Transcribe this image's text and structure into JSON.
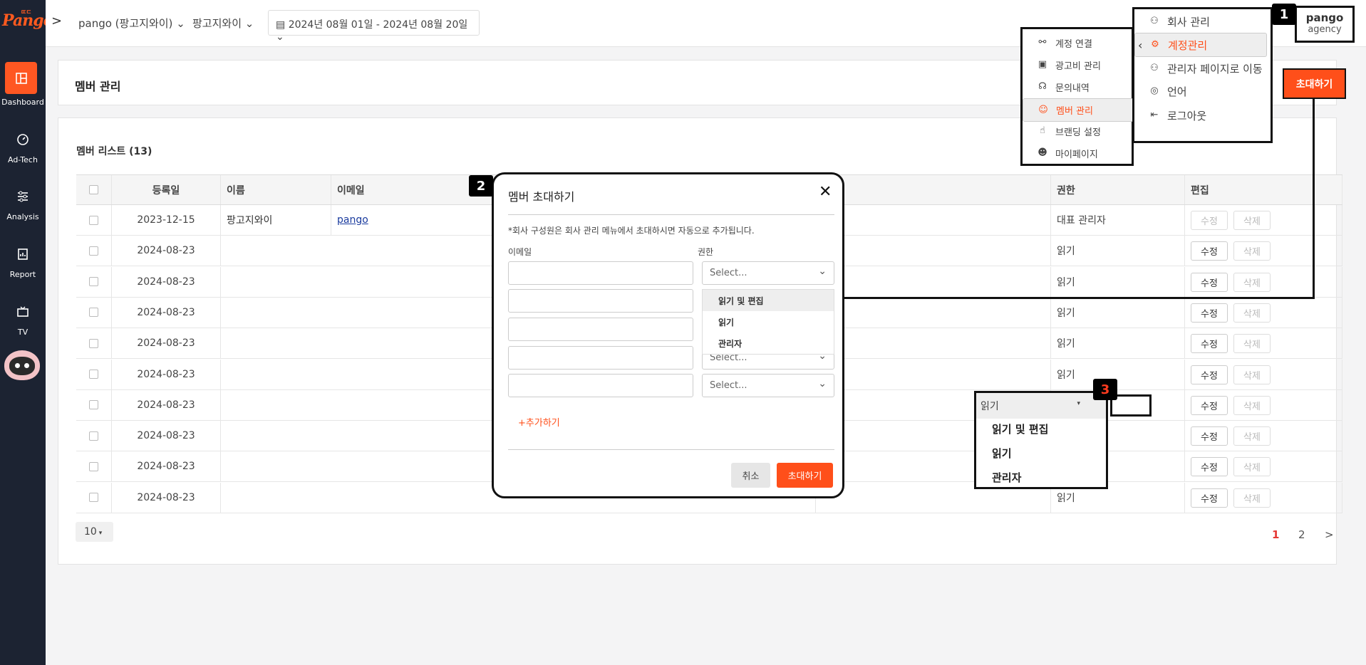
{
  "sidebar": {
    "logo_main": "Pango",
    "logo_small": "ㄸㄷ",
    "items": [
      {
        "label": "Dashboard",
        "icon": "dashboard-icon",
        "active": true
      },
      {
        "label": "Ad-Tech",
        "icon": "gauge-icon"
      },
      {
        "label": "Analysis",
        "icon": "sliders-icon"
      },
      {
        "label": "Report",
        "icon": "report-icon"
      },
      {
        "label": "TV",
        "icon": "tv-icon"
      }
    ]
  },
  "topbar": {
    "expand": ">",
    "account_select": "pango (팡고지와이)",
    "company_select": "팡고지와이",
    "date_range": "2024년 08월 01일 - 2024년 08월 20일",
    "profile_name": "pango",
    "profile_role": "agency"
  },
  "page": {
    "title": "멤버 관리",
    "list_title": "멤버 리스트 (13)",
    "invite_button": "초대하기"
  },
  "table": {
    "headers": {
      "date": "등록일",
      "name": "이름",
      "email": "이메일",
      "role": "권한",
      "edit": "편집"
    },
    "rows": [
      {
        "date": "2023-12-15",
        "name": "팡고지와이",
        "email": "pango",
        "role": "대표 관리자"
      },
      {
        "date": "2024-08-23",
        "role": "읽기"
      },
      {
        "date": "2024-08-23",
        "role": "읽기"
      },
      {
        "date": "2024-08-23",
        "role": "읽기"
      },
      {
        "date": "2024-08-23",
        "role": "읽기"
      },
      {
        "date": "2024-08-23",
        "role": "읽기"
      },
      {
        "date": "2024-08-23",
        "role": "읽기"
      },
      {
        "date": "2024-08-23",
        "role": "읽기"
      },
      {
        "date": "2024-08-23",
        "role": "읽기"
      },
      {
        "date": "2024-08-23",
        "role": "읽기"
      }
    ],
    "edit_label": "수정",
    "delete_label": "삭제",
    "page_size": "10",
    "pages": [
      "1",
      "2"
    ],
    "next": ">"
  },
  "account_menu": {
    "items": [
      "회사 관리",
      "계정관리",
      "관리자 페이지로 이동",
      "언어",
      "로그아웃"
    ],
    "icons": [
      "org-icon",
      "user-gear-icon",
      "admin-icon",
      "globe-icon",
      "logout-icon"
    ]
  },
  "sub_menu": {
    "items": [
      "계정 연결",
      "광고비 관리",
      "문의내역",
      "멤버 관리",
      "브랜딩 설정",
      "마이페이지"
    ],
    "icons": [
      "network-icon",
      "money-icon",
      "headset-icon",
      "member-icon",
      "click-icon",
      "user-circle-icon"
    ]
  },
  "modal": {
    "title": "멤버 초대하기",
    "notice": "*회사 구성원은 회사 관리 메뉴에서 초대하시면 자동으로 추가됩니다.",
    "email_label": "이메일",
    "role_label": "권한",
    "select_placeholder": "Select...",
    "dropdown_options": [
      "읽기 및 편집",
      "읽기",
      "관리자"
    ],
    "add_more": "+추가하기",
    "cancel": "취소",
    "submit": "초대하기"
  },
  "role_dropdown": {
    "current": "읽기",
    "options": [
      "읽기 및 편집",
      "읽기",
      "관리자"
    ]
  },
  "annotations": [
    "1",
    "2",
    "3"
  ],
  "colors": {
    "accent": "#ff4f1a",
    "sidebar": "#1c2332"
  }
}
